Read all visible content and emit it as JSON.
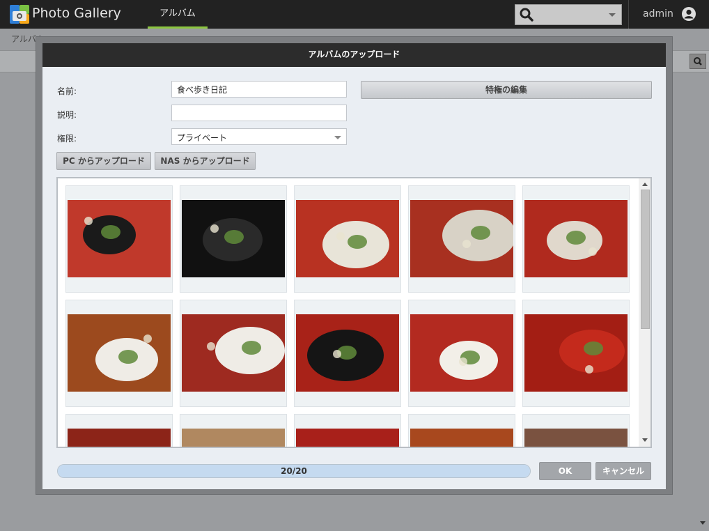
{
  "header": {
    "app_title": "Photo Gallery",
    "nav_tab": "アルバム",
    "user": "admin",
    "accent_color": "#8cc63f"
  },
  "page": {
    "breadcrumb": "アルバム"
  },
  "dialog": {
    "title": "アルバムのアップロード",
    "name_label": "名前:",
    "name_value": "食べ歩き日記",
    "description_label": "説明:",
    "description_value": "",
    "permission_label": "権限:",
    "permission_value": "プライベート",
    "edit_privileges_button": "特権の編集",
    "upload_pc_button": "PC からアップロード",
    "upload_nas_button": "NAS からアップロード",
    "progress_text": "20/20",
    "progress_fraction": 1.0,
    "ok_button": "OK",
    "cancel_button": "キャンセル"
  },
  "thumbnails": [
    {
      "name": "photo-1",
      "bg": "#c0392b",
      "dish": "#1a1a1a"
    },
    {
      "name": "photo-2",
      "bg": "#111111",
      "dish": "#2a2a2a"
    },
    {
      "name": "photo-3",
      "bg": "#b83222",
      "dish": "#e8e4d8"
    },
    {
      "name": "photo-4",
      "bg": "#a83020",
      "dish": "#d8d2c6"
    },
    {
      "name": "photo-5",
      "bg": "#b02a1e",
      "dish": "#e0d8cc"
    },
    {
      "name": "photo-6",
      "bg": "#9c4a1e",
      "dish": "#efece6"
    },
    {
      "name": "photo-7",
      "bg": "#9e2a20",
      "dish": "#efece6"
    },
    {
      "name": "photo-8",
      "bg": "#a82218",
      "dish": "#151515"
    },
    {
      "name": "photo-9",
      "bg": "#b32a20",
      "dish": "#f2efe8"
    },
    {
      "name": "photo-10",
      "bg": "#a31e14",
      "dish": "#c42a1c"
    },
    {
      "name": "photo-11",
      "bg": "#8c2418",
      "dish": "#7a2a20"
    },
    {
      "name": "photo-12",
      "bg": "#b08860",
      "dish": "#dcd8d4"
    },
    {
      "name": "photo-13",
      "bg": "#a8201a",
      "dish": "#ece8e0"
    },
    {
      "name": "photo-14",
      "bg": "#a8481e",
      "dish": "#5a4a40"
    },
    {
      "name": "photo-15",
      "bg": "#7a5240",
      "dish": "#bdb6ae"
    }
  ]
}
